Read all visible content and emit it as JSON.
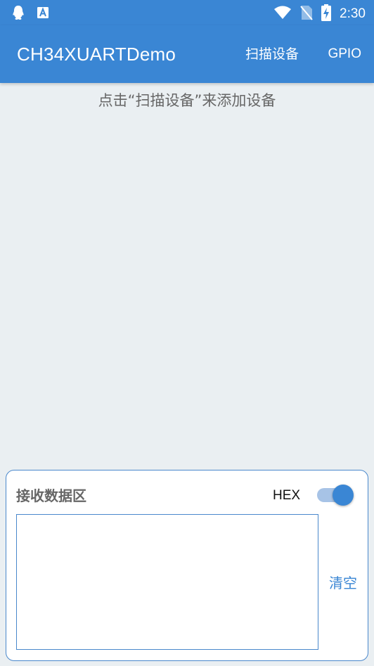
{
  "status_bar": {
    "time": "2:30",
    "left_icons": [
      "qq-notification-icon",
      "text-a-icon"
    ],
    "right_icons": [
      "wifi-icon",
      "no-sim-icon",
      "battery-charging-icon"
    ]
  },
  "app_bar": {
    "title": "CH34XUARTDemo",
    "actions": {
      "scan": "扫描设备",
      "gpio": "GPIO"
    }
  },
  "hint": "点击“扫描设备”来添加设备",
  "receive_panel": {
    "title": "接收数据区",
    "hex_label": "HEX",
    "hex_enabled": true,
    "content": "",
    "clear_label": "清空"
  },
  "colors": {
    "primary": "#3a86d4",
    "background": "#eaeff2",
    "switch_track": "#a7c3e6",
    "hint_text": "#666666"
  }
}
